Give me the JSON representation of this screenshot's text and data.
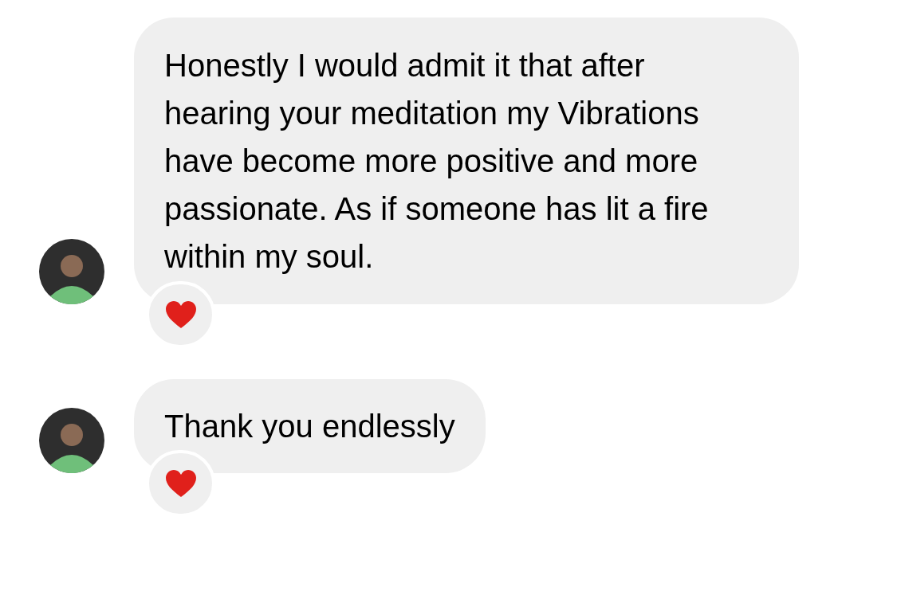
{
  "messages": [
    {
      "text": "Honestly I would admit it that after hearing your meditation my Vibrations have become more positive and more passionate. As if someone has lit a fire within my soul.",
      "hearted": true
    },
    {
      "text": "Thank you endlessly",
      "hearted": true
    }
  ]
}
